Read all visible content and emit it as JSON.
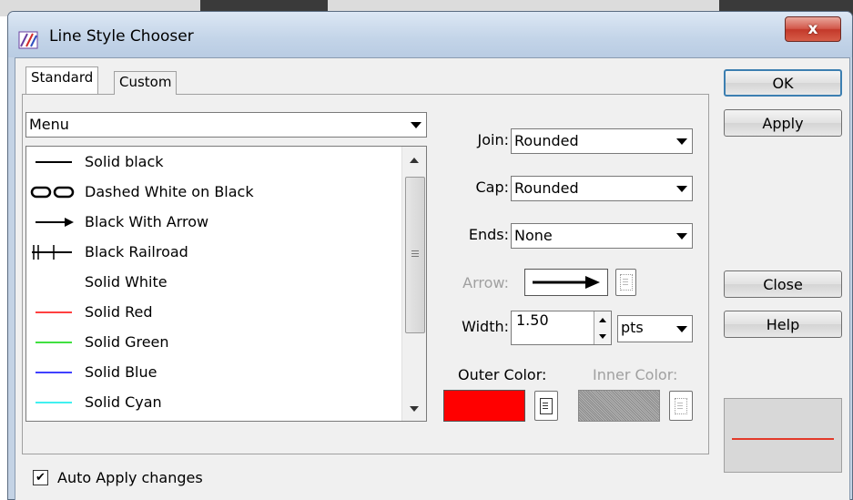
{
  "window": {
    "title": "Line Style Chooser",
    "close_glyph": "x"
  },
  "tabs": [
    {
      "label": "Standard",
      "active": true
    },
    {
      "label": "Custom",
      "active": false
    }
  ],
  "category_combo": {
    "value": "Menu"
  },
  "styles": [
    {
      "label": "Solid black",
      "line_color": "#000000",
      "kind": "solid"
    },
    {
      "label": "Dashed White on Black",
      "line_color": "#000000",
      "kind": "dashed-white-on-black"
    },
    {
      "label": "Black With Arrow",
      "line_color": "#000000",
      "kind": "arrow"
    },
    {
      "label": "Black Railroad",
      "line_color": "#000000",
      "kind": "railroad"
    },
    {
      "label": "Solid White",
      "line_color": "#ffffff",
      "kind": "solid"
    },
    {
      "label": "Solid Red",
      "line_color": "#ff4040",
      "kind": "solid"
    },
    {
      "label": "Solid Green",
      "line_color": "#40e040",
      "kind": "solid"
    },
    {
      "label": "Solid Blue",
      "line_color": "#4040ff",
      "kind": "solid"
    },
    {
      "label": "Solid Cyan",
      "line_color": "#40f0f0",
      "kind": "solid"
    }
  ],
  "props": {
    "join_label": "Join:",
    "join_value": "Rounded",
    "cap_label": "Cap:",
    "cap_value": "Rounded",
    "ends_label": "Ends:",
    "ends_value": "None",
    "arrow_label": "Arrow:",
    "width_label": "Width:",
    "width_value": "1.50",
    "units_value": "pts",
    "outer_color_label": "Outer Color:",
    "outer_color": "#ff0000",
    "inner_color_label": "Inner Color:",
    "inner_color": "#9a9a9a"
  },
  "buttons": {
    "ok": "OK",
    "apply": "Apply",
    "close": "Close",
    "help": "Help"
  },
  "auto_apply": {
    "label": "Auto Apply changes",
    "checked": true
  },
  "preview": {
    "line_color": "#e23a2a"
  },
  "colors": {
    "accent": "#3c7fb1",
    "client_bg": "#f0f0f0",
    "frame_bg": "#c4d3e5"
  }
}
